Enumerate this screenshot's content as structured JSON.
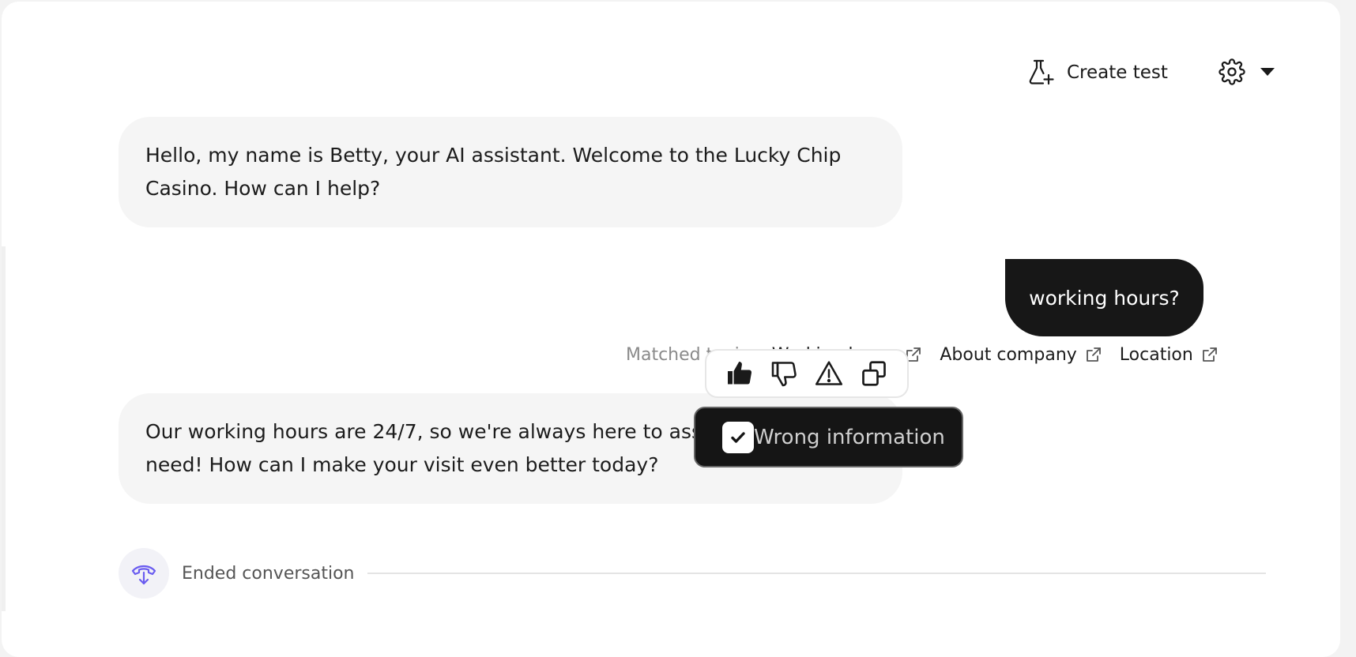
{
  "toolbar": {
    "create_test_label": "Create test",
    "create_test_icon": "flask-plus-icon",
    "settings_icon": "gear-icon",
    "dropdown_icon": "caret-down-icon"
  },
  "messages": {
    "bot_greeting": "Hello, my name is Betty, your AI assistant. Welcome to the Lucky Chip Casino. How can I help?",
    "user_question": "working hours?",
    "bot_answer": "Our working hours are 24/7, so we're always here to assist whenever you need! How can I make your visit even better today?"
  },
  "matched": {
    "label": "Matched topics:",
    "topics": [
      {
        "label": "Working hours",
        "icon": "external-link-icon"
      },
      {
        "label": "About company",
        "icon": "external-link-icon"
      },
      {
        "label": "Location",
        "icon": "external-link-icon"
      }
    ]
  },
  "feedback": {
    "icons": [
      "thumbs-up-icon",
      "thumbs-down-icon",
      "warning-icon",
      "copy-icon"
    ],
    "wrong_information_label": "Wrong information",
    "wrong_information_checked": true
  },
  "status": {
    "ended_label": "Ended conversation",
    "ended_icon": "hang-up-icon"
  },
  "colors": {
    "accent": "#6a5cf0",
    "user_bubble": "#171717",
    "bot_bubble": "#f5f5f5"
  }
}
